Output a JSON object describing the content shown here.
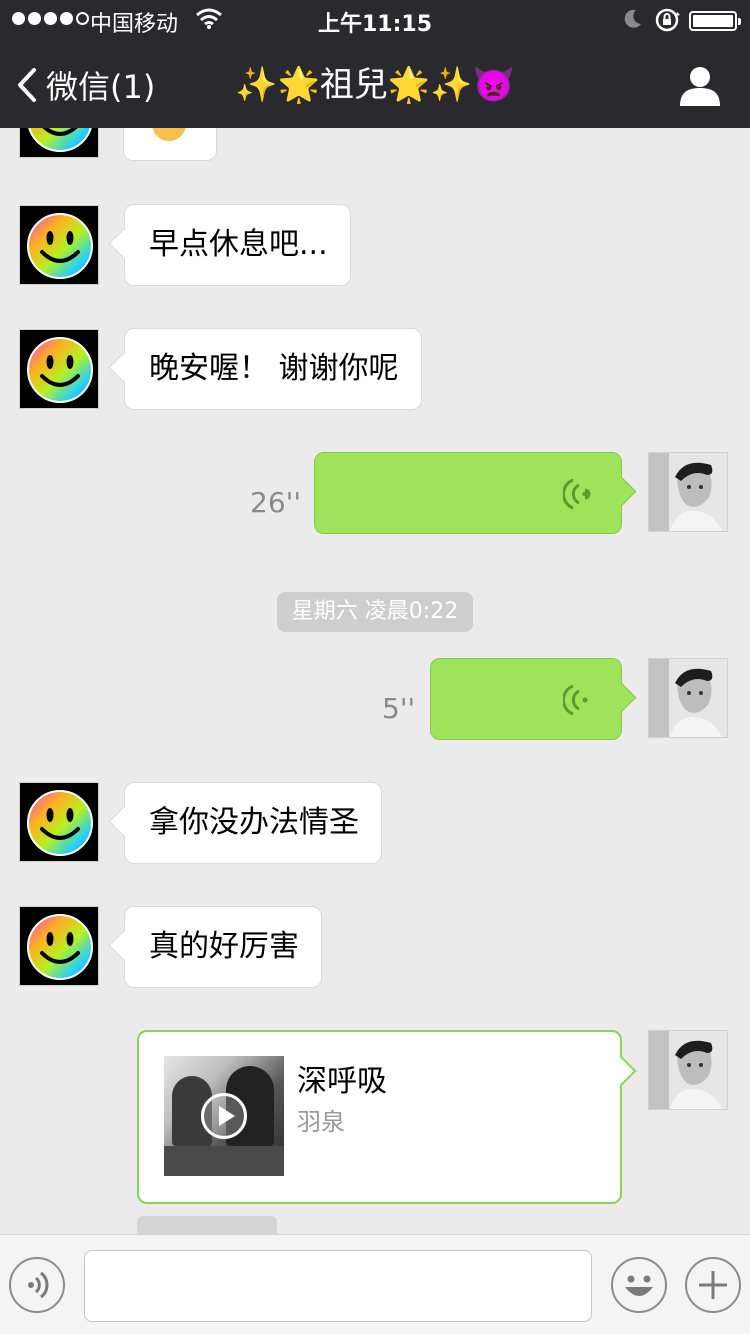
{
  "status_bar": {
    "carrier": "中国移动",
    "time": "上午11:15"
  },
  "nav": {
    "back_label": "微信(1)",
    "title": "✨🌟祖兒🌟✨👿"
  },
  "messages": [
    {
      "type": "text",
      "side": "in",
      "text": "早点休息吧..."
    },
    {
      "type": "text",
      "side": "in",
      "text": "晚安喔！ 谢谢你呢"
    },
    {
      "type": "voice",
      "side": "out",
      "duration": "26''"
    },
    {
      "type": "timestamp",
      "text": "星期六 凌晨0:22"
    },
    {
      "type": "voice",
      "side": "out",
      "duration": "5''"
    },
    {
      "type": "text",
      "side": "in",
      "text": " 拿你没办法情圣"
    },
    {
      "type": "text",
      "side": "in",
      "text": "真的好厉害"
    },
    {
      "type": "music",
      "side": "out",
      "title": "深呼吸",
      "artist": "羽泉"
    }
  ],
  "colors": {
    "nav_bg": "#2a2a2e",
    "chat_bg": "#ebebeb",
    "outgoing_bubble": "#9fe35a",
    "incoming_bubble": "#ffffff",
    "music_border": "#8fd05a"
  },
  "input": {
    "value": "",
    "placeholder": ""
  },
  "icons": {
    "voice_toggle": "voice-mode-icon",
    "emoji": "emoji-icon",
    "add": "plus-icon",
    "profile": "person-icon"
  }
}
